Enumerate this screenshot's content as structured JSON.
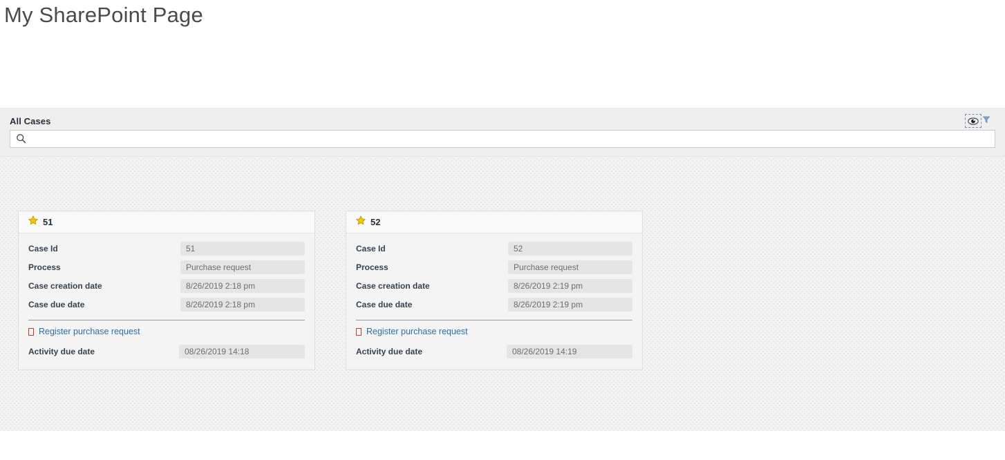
{
  "page": {
    "title": "My SharePoint Page"
  },
  "widget": {
    "title": "All Cases",
    "search": {
      "value": "",
      "placeholder": "",
      "icon": "search-icon"
    },
    "view_selector": {
      "eye_icon": "eye-icon",
      "filter_icon": "funnel-icon"
    },
    "colors": {
      "link": "#2e6da4",
      "star": "#f2c200",
      "header_bg": "#efefef",
      "value_bg": "#e5e5e5"
    }
  },
  "cards": [
    {
      "star_icon": "star-icon",
      "title": "51",
      "fields": [
        {
          "label": "Case Id",
          "value": "51"
        },
        {
          "label": "Process",
          "value": "Purchase request"
        },
        {
          "label": "Case creation date",
          "value": "8/26/2019 2:18 pm"
        },
        {
          "label": "Case due date",
          "value": "8/26/2019 2:18 pm"
        }
      ],
      "activity": {
        "link_icon": "tofu-icon",
        "link_label": "Register purchase request",
        "field": {
          "label": "Activity due date",
          "value": "08/26/2019 14:18"
        }
      }
    },
    {
      "star_icon": "star-icon",
      "title": "52",
      "fields": [
        {
          "label": "Case Id",
          "value": "52"
        },
        {
          "label": "Process",
          "value": "Purchase request"
        },
        {
          "label": "Case creation date",
          "value": "8/26/2019 2:19 pm"
        },
        {
          "label": "Case due date",
          "value": "8/26/2019 2:19 pm"
        }
      ],
      "activity": {
        "link_icon": "tofu-icon",
        "link_label": "Register purchase request",
        "field": {
          "label": "Activity due date",
          "value": "08/26/2019 14:19"
        }
      }
    }
  ]
}
